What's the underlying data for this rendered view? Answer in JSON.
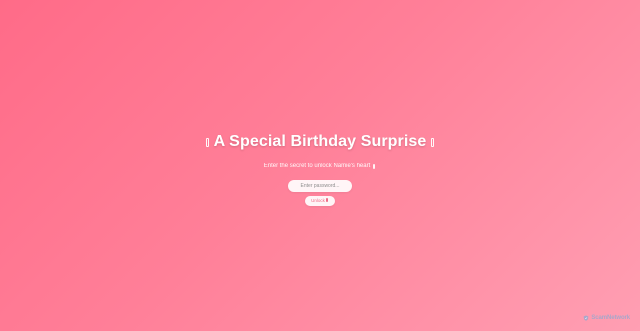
{
  "header": {
    "title": "A Special Birthday Surprise",
    "subtitle": "Enter the secret to unlock Namie's heart"
  },
  "form": {
    "password_placeholder": "Enter password...",
    "unlock_label": "Unlock"
  },
  "watermark": {
    "text": "ScamNetwork"
  },
  "colors": {
    "gradient_start": "#ff6b88",
    "gradient_end": "#ff9fb3",
    "button_text": "#f06b86"
  }
}
